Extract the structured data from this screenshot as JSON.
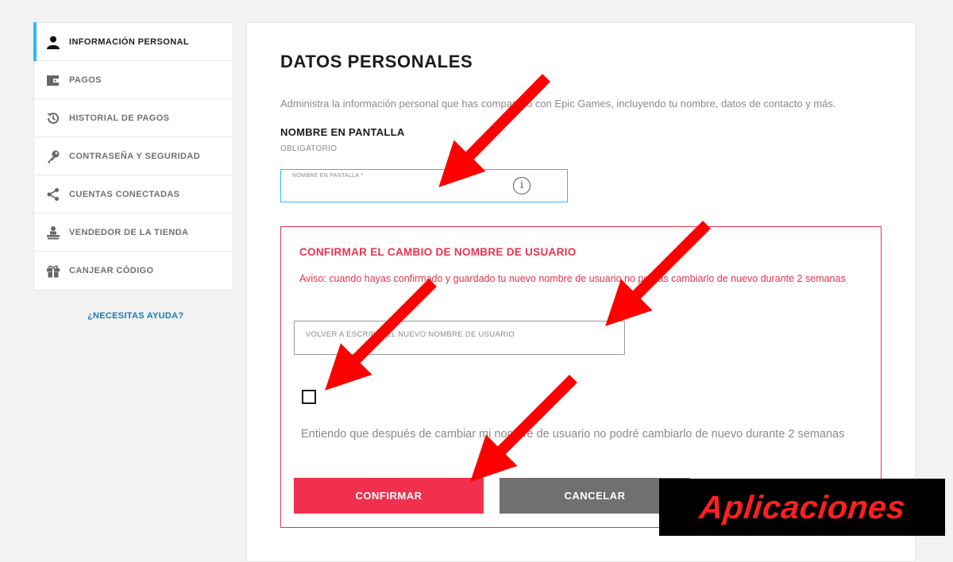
{
  "sidebar": {
    "items": [
      {
        "label": "INFORMACIÓN PERSONAL",
        "icon": "person-icon"
      },
      {
        "label": "PAGOS",
        "icon": "wallet-icon"
      },
      {
        "label": "HISTORIAL DE PAGOS",
        "icon": "history-icon"
      },
      {
        "label": "CONTRASEÑA Y SEGURIDAD",
        "icon": "key-icon"
      },
      {
        "label": "CUENTAS CONECTADAS",
        "icon": "share-icon"
      },
      {
        "label": "VENDEDOR DE LA TIENDA",
        "icon": "seller-icon"
      },
      {
        "label": "CANJEAR CÓDIGO",
        "icon": "gift-icon"
      }
    ],
    "help_link": "¿NECESITAS AYUDA?"
  },
  "main": {
    "title": "DATOS PERSONALES",
    "description": "Administra la información personal que has compartido con Epic Games, incluyendo tu nombre, datos de contacto y más.",
    "display_name": {
      "title": "NOMBRE EN PANTALLA",
      "required": "OBLIGATORIO",
      "float_label": "NOMBRE EN PANTALLA *",
      "value": ""
    },
    "confirm": {
      "title": "CONFIRMAR EL CAMBIO DE NOMBRE DE USUARIO",
      "warning": "Aviso: cuando hayas confirmado y guardado tu nuevo nombre de usuario no podrás cambiarlo de nuevo durante 2 semanas",
      "retype_placeholder": "VOLVER A ESCRIBIR EL NUEVO NOMBRE DE USUARIO",
      "checkbox_checked": false,
      "checkbox_label": "Entiendo que después de cambiar mi nombre de usuario no podré cambiarlo de nuevo durante 2 semanas",
      "confirm_button": "CONFIRMAR",
      "cancel_button": "CANCELAR"
    }
  },
  "overlay": {
    "brand": "Aplicaciones",
    "arrow_color": "#ff0000"
  },
  "colors": {
    "accent_blue": "#26bbff",
    "danger_red": "#e8344e",
    "confirm_red": "#f0304d",
    "cancel_gray": "#707070"
  }
}
